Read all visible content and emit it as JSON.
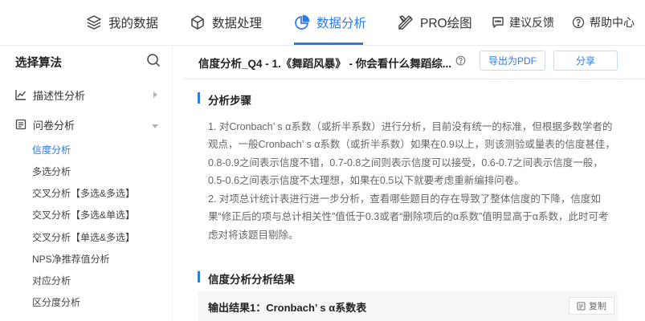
{
  "nav": {
    "items": [
      {
        "label": "我的数据"
      },
      {
        "label": "数据处理"
      },
      {
        "label": "数据分析"
      },
      {
        "label": "PRO绘图"
      },
      {
        "label": "建议反馈"
      },
      {
        "label": "帮助中心"
      }
    ],
    "active_color": "#2d7be5"
  },
  "sidebar": {
    "title": "选择算法",
    "groups": [
      {
        "label": "描述性分析",
        "expanded": false
      },
      {
        "label": "问卷分析",
        "expanded": true
      }
    ],
    "items": [
      {
        "label": "信度分析",
        "active": true
      },
      {
        "label": "多选分析"
      },
      {
        "label": "交叉分析【多选&多选】"
      },
      {
        "label": "交叉分析【多选&单选】"
      },
      {
        "label": "交叉分析【单选&多选】"
      },
      {
        "label": "NPS净推荐值分析"
      },
      {
        "label": "对应分析"
      },
      {
        "label": "区分度分析"
      }
    ]
  },
  "header": {
    "title": "信度分析_Q4 - 1.《舞蹈风暴》 - 你会看什么舞蹈综...",
    "export_pdf": "导出为PDF",
    "share": "分享"
  },
  "sections": {
    "steps_title": "分析步骤",
    "steps_paragraphs": [
      "1. 对Cronbach’ s α系数（或折半系数）进行分析，目前没有统一的标准，但根据多数学者的观点，一般Cronbach’ s α系数（或折半系数）如果在0.9以上，则该测验或量表的信度甚佳，0.8-0.9之间表示信度不错，0.7-0.8之间则表示信度可以接受，0.6-0.7之间表示信度一般，0.5-0.6之间表示信度不太理想，如果在0.5以下就要考虑重新编排问卷。",
      "2. 对项总计统计表进行进一步分析，查看哪些题目的存在导致了整体信度的下降，信度如果“修正后的项与总计相关性”值低于0.3或者“删除项后的α系数”值明显高于α系数，此时可考虑对将该题目剔除。"
    ],
    "result_title": "信度分析分析结果",
    "output_title": "输出结果1：Cronbach’ s α系数表",
    "copy_label": "复制"
  }
}
